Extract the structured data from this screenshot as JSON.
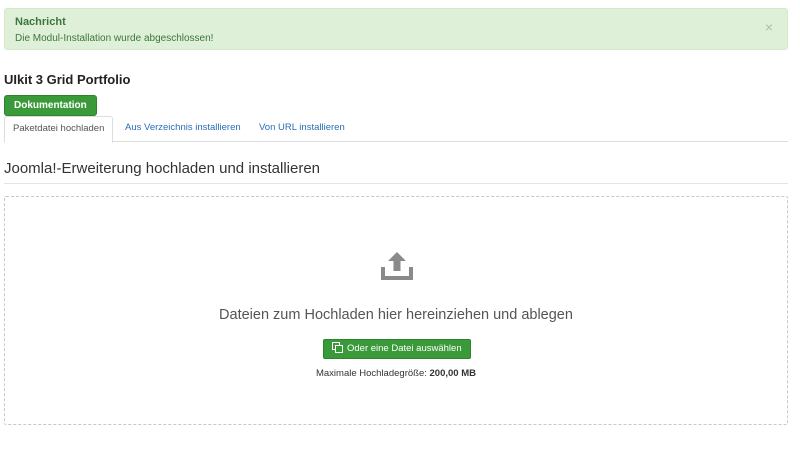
{
  "alert": {
    "heading": "Nachricht",
    "message": "Die Modul-Installation wurde abgeschlossen!",
    "close_symbol": "×"
  },
  "extension": {
    "title": "UIkit 3 Grid Portfolio",
    "doc_button": "Dokumentation"
  },
  "tabs": [
    {
      "label": "Paketdatei hochladen",
      "active": true
    },
    {
      "label": "Aus Verzeichnis installieren",
      "active": false
    },
    {
      "label": "Von URL installieren",
      "active": false
    }
  ],
  "section": {
    "title": "Joomla!-Erweiterung hochladen und installieren"
  },
  "dropzone": {
    "icon": "upload-icon",
    "text": "Dateien zum Hochladen hier hereinziehen und ablegen",
    "select_button": "Oder eine Datei auswählen",
    "select_icon": "copy-icon",
    "max_size_label": "Maximale Hochladegröße:",
    "max_size_value": "200,00 MB"
  },
  "colors": {
    "alert_bg": "#dff0d8",
    "alert_text": "#3c763d",
    "success_button": "#3a9a3a",
    "link": "#2a6fb5"
  }
}
